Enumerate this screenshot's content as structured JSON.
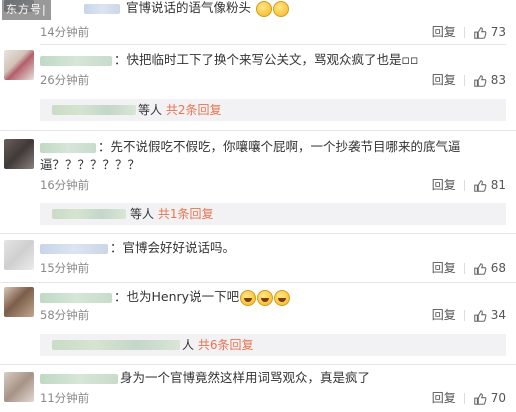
{
  "watermark": "东方号|",
  "comments": [
    {
      "text": "官博说话的语气像粉头",
      "time": "14分钟前",
      "reply": "回复",
      "likes": "73"
    },
    {
      "text": "快把临时工下了换个来写公关文，骂观众疯了也是",
      "time": "26分钟前",
      "reply": "回复",
      "likes": "83",
      "sub": {
        "suffix": "等人",
        "summary": "共2条回复"
      }
    },
    {
      "text": "先不说假吃不假吃，你嚷嚷个屁啊，一个抄袭节目哪来的底气逼",
      "text2": "逼？？？？？？？",
      "time": "16分钟前",
      "reply": "回复",
      "likes": "81",
      "sub": {
        "suffix": "等人",
        "summary": "共1条回复"
      }
    },
    {
      "text": "官博会好好说话吗。",
      "time": "15分钟前",
      "reply": "回复",
      "likes": "68"
    },
    {
      "text": "也为Henry说一下吧",
      "time": "58分钟前",
      "reply": "回复",
      "likes": "34",
      "sub": {
        "suffix": "人",
        "summary": "共6条回复"
      }
    },
    {
      "text": "身为一个官博竟然这样用词骂观众，真是疯了",
      "time": "11分钟前",
      "reply": "回复",
      "likes": "70"
    }
  ],
  "icons": {
    "like": "thumbs-up-icon",
    "emoji": "smile-emoji-icon"
  },
  "colors": {
    "link": "#eb7350",
    "meta": "#888888",
    "subbox": "#f2f2f5"
  }
}
